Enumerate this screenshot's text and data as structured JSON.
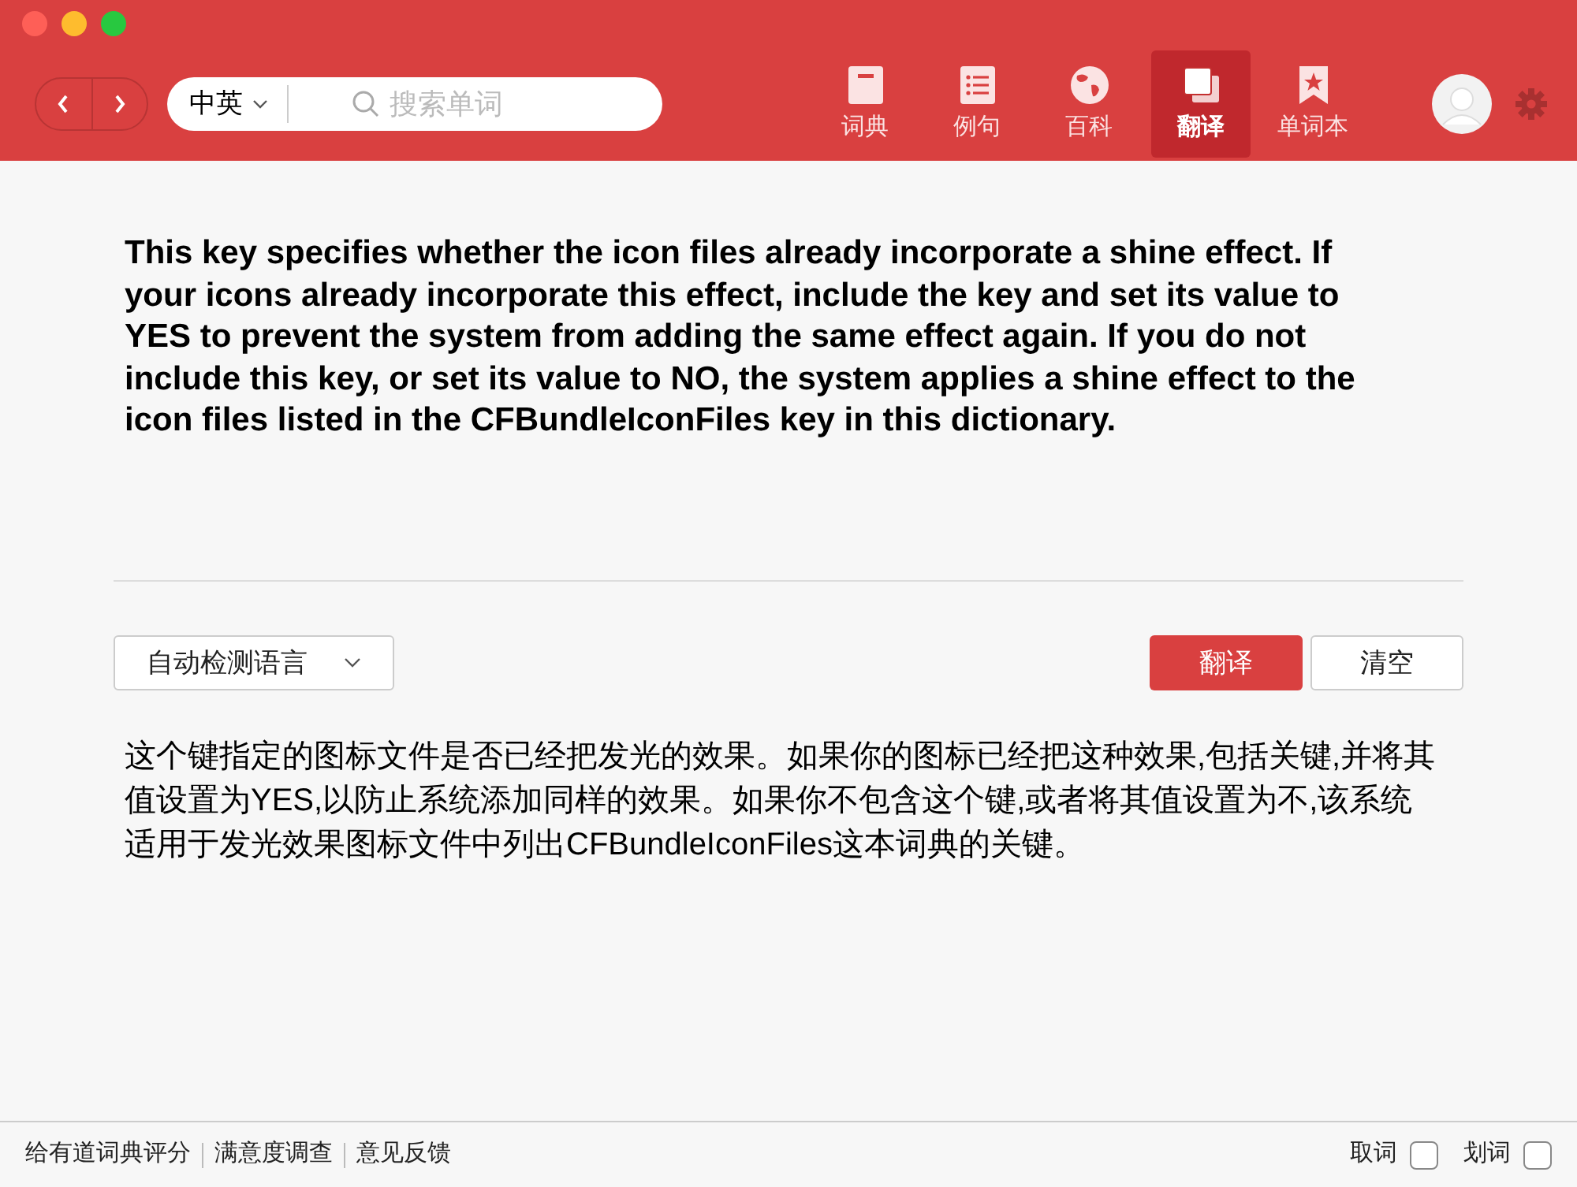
{
  "toolbar": {
    "language": "中英",
    "search": {
      "placeholder": "搜索单词"
    },
    "tabs": [
      {
        "label": "词典",
        "selected": false
      },
      {
        "label": "例句",
        "selected": false
      },
      {
        "label": "百科",
        "selected": false
      },
      {
        "label": "翻译",
        "selected": true
      },
      {
        "label": "单词本",
        "selected": false
      }
    ]
  },
  "source_text": "This key specifies whether the icon files already incorporate a shine effect. If your icons already incorporate this effect, include the key and set its value to YES to prevent the system from adding the same effect again. If you do not include this key, or set its value to NO, the system applies a shine effect to the icon files listed in the CFBundleIconFiles key in this dictionary.",
  "language_select": "自动检测语言",
  "buttons": [
    {
      "label": "翻译",
      "kind": "primary"
    },
    {
      "label": "清空",
      "kind": "secondary"
    }
  ],
  "result_text": "这个键指定的图标文件是否已经把发光的效果。如果你的图标已经把这种效果,包括关键,并将其值设置为YES,以防止系统添加同样的效果。如果你不包含这个键,或者将其值设置为不,该系统适用于发光效果图标文件中列出CFBundleIconFiles这本词典的关键。",
  "footer": {
    "links": [
      "给有道词典评分",
      "满意度调查",
      "意见反馈"
    ],
    "toggles": [
      {
        "label": "取词",
        "checked": false
      },
      {
        "label": "划词",
        "checked": false
      }
    ]
  }
}
